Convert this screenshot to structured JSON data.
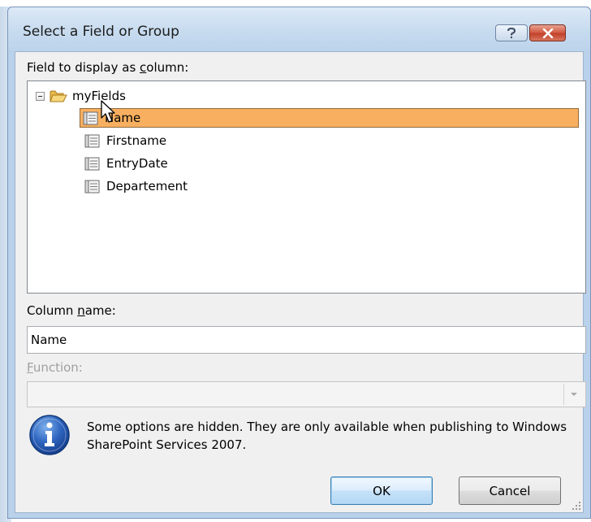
{
  "dialog": {
    "title": "Select a Field or Group",
    "help_icon": "help-question-icon",
    "close_icon": "close-x-icon"
  },
  "field_label": "Field to display as column:",
  "tree": {
    "root": {
      "label": "myFields",
      "icon": "folder-open-icon",
      "expanded": true
    },
    "items": [
      {
        "label": "Name",
        "icon": "field-icon",
        "selected": true
      },
      {
        "label": "Firstname",
        "icon": "field-icon",
        "selected": false
      },
      {
        "label": "EntryDate",
        "icon": "field-icon",
        "selected": false
      },
      {
        "label": "Departement",
        "icon": "field-icon",
        "selected": false
      }
    ]
  },
  "column_name": {
    "label": "Column name:",
    "value": "Name"
  },
  "function": {
    "label": "Function:",
    "value": "",
    "disabled": true
  },
  "info": {
    "icon": "info-icon",
    "text": "Some options are hidden. They are only available when publishing to Windows SharePoint Services 2007."
  },
  "buttons": {
    "ok": "OK",
    "cancel": "Cancel"
  },
  "colors": {
    "selection": "#f8b060",
    "selection_border": "#8f6a3a",
    "frame": "#b9d1ea",
    "close": "#c2412a"
  }
}
